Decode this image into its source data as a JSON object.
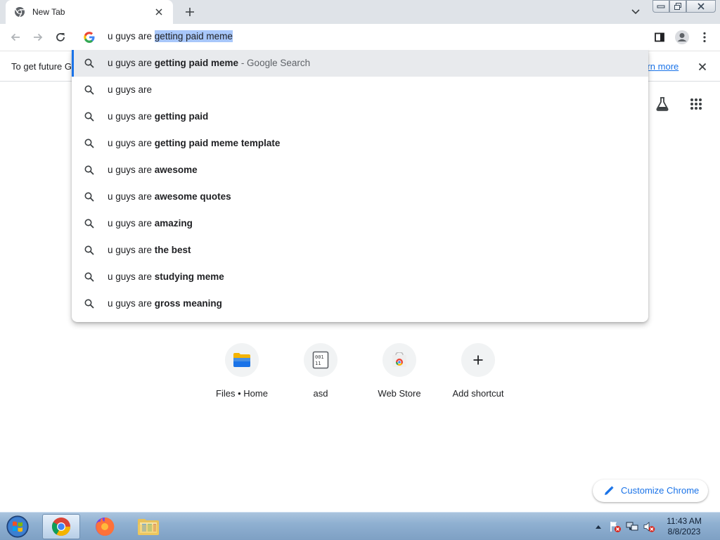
{
  "browser": {
    "tab": {
      "title": "New Tab",
      "close_icon": "close-icon",
      "favicon": "chrome-icon"
    },
    "omnibox": {
      "typed": "u guys are ",
      "autocomplete": "getting paid meme",
      "provider_icon": "google-g-icon"
    },
    "toolbar_icons": [
      "back-arrow-icon",
      "forward-arrow-icon",
      "reload-icon",
      "side-panel-icon",
      "profile-icon",
      "more-menu-icon"
    ]
  },
  "infobar": {
    "message": "To get future G",
    "link": "earn more"
  },
  "suggestions": [
    {
      "prefix": "u guys are ",
      "bold": "getting paid meme",
      "suffix": " - Google Search"
    },
    {
      "prefix": "u guys are",
      "bold": "",
      "suffix": ""
    },
    {
      "prefix": "u guys are ",
      "bold": "getting paid",
      "suffix": ""
    },
    {
      "prefix": "u guys are ",
      "bold": "getting paid meme template",
      "suffix": ""
    },
    {
      "prefix": "u guys are ",
      "bold": "awesome",
      "suffix": ""
    },
    {
      "prefix": "u guys are ",
      "bold": "awesome quotes",
      "suffix": ""
    },
    {
      "prefix": "u guys are ",
      "bold": "amazing",
      "suffix": ""
    },
    {
      "prefix": "u guys are ",
      "bold": "the best",
      "suffix": ""
    },
    {
      "prefix": "u guys are ",
      "bold": "studying meme",
      "suffix": ""
    },
    {
      "prefix": "u guys are ",
      "bold": "gross meaning",
      "suffix": ""
    }
  ],
  "shortcuts": [
    {
      "label": "Files • Home",
      "icon": "folder-icon"
    },
    {
      "label": "asd",
      "icon": "binary-file-icon"
    },
    {
      "label": "Web Store",
      "icon": "web-store-icon"
    },
    {
      "label": "Add shortcut",
      "icon": "plus-icon"
    }
  ],
  "customize": {
    "label": "Customize Chrome"
  },
  "taskbar": {
    "time": "11:43 AM",
    "date": "8/8/2023",
    "apps": [
      "chrome-icon",
      "firefox-icon",
      "file-explorer-icon"
    ]
  },
  "colors": {
    "accent": "#1a73e8",
    "selection": "#a8c7fa",
    "tabstrip": "#dfe3e8"
  }
}
